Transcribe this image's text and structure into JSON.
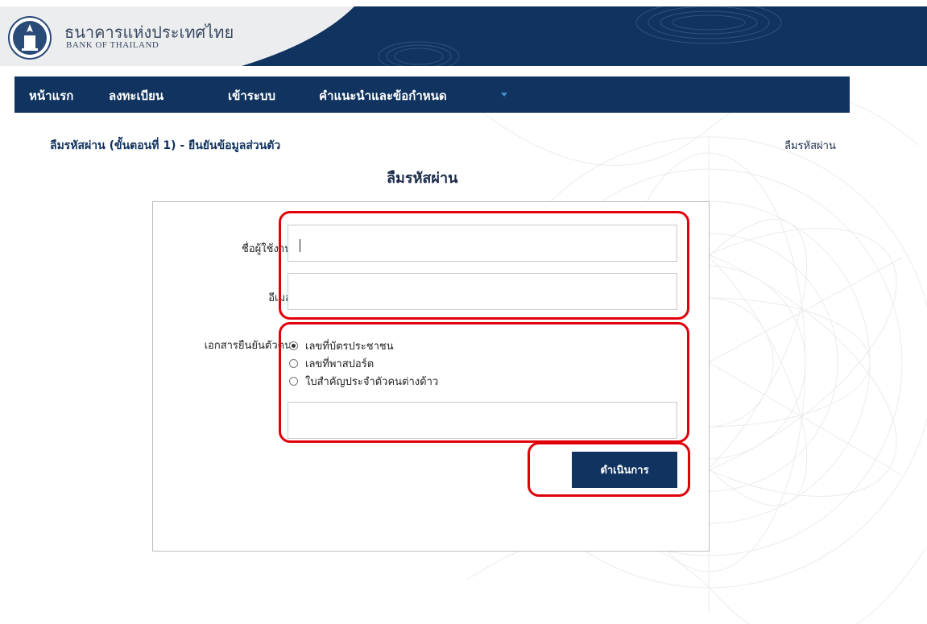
{
  "header": {
    "bank_name_th": "ธนาคารแห่งประเทศไทย",
    "bank_name_en": "BANK OF THAILAND"
  },
  "nav": {
    "items": [
      {
        "label": "หน้าแรก"
      },
      {
        "label": "ลงทะเบียน"
      },
      {
        "label": "เข้าระบบ"
      },
      {
        "label": "คำแนะนำและข้อกำหนด"
      }
    ]
  },
  "breadcrumb": "ลืมรหัสผ่าน (ขั้นตอนที่ 1) - ยืนยันข้อมูลส่วนตัว",
  "breadcrumb_right": "ลืมรหัสผ่าน",
  "page_title": "ลืมรหัสผ่าน",
  "form": {
    "username_label": "ชื่อผู้ใช้งาน",
    "username_value": "",
    "email_label": "อีเมล",
    "email_value": "",
    "id_doc_label": "เอกสารยืนยันตัวตน",
    "id_doc_options": [
      {
        "label": "เลขที่บัตรประชาชน",
        "selected": true
      },
      {
        "label": "เลขที่พาสปอร์ต",
        "selected": false
      },
      {
        "label": "ใบสำคัญประจำตัวคนต่างด้าว",
        "selected": false
      }
    ],
    "id_number_value": "",
    "submit_label": "ดำเนินการ"
  },
  "colors": {
    "brand_navy": "#10335f",
    "highlight_red": "#e0000a",
    "caret_blue": "#3d8fd1"
  }
}
